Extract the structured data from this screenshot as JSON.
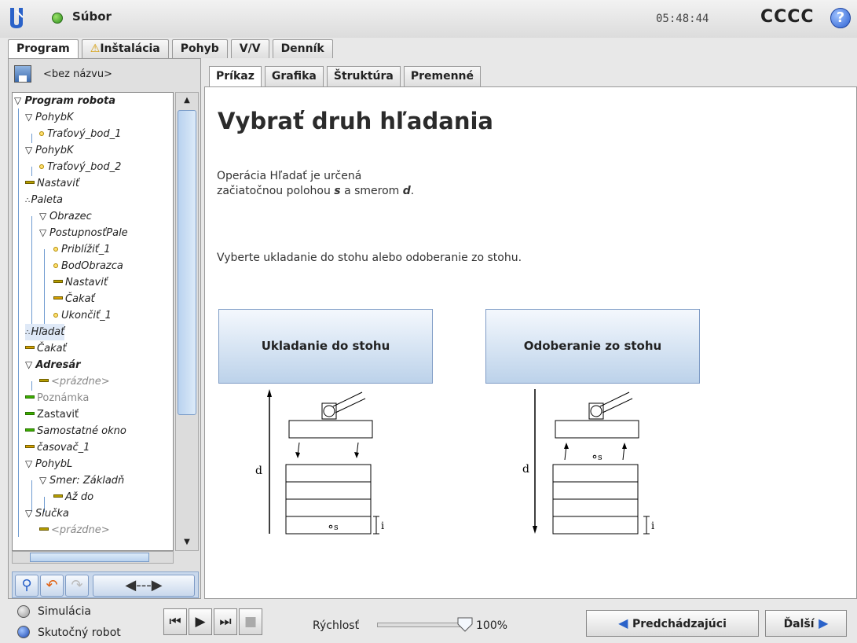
{
  "topbar": {
    "file_menu": "Súbor",
    "clock": "05:48:44",
    "robot_name": "CCCC",
    "help": "?"
  },
  "main_tabs": [
    "Program",
    "Inštalácia",
    "Pohyb",
    "V/V",
    "Denník"
  ],
  "program": {
    "name": "<bez názvu>"
  },
  "tree": [
    "Program robota",
    "PohybK",
    "Traťový_bod_1",
    "PohybK",
    "Traťový_bod_2",
    "Nastaviť",
    "Paleta",
    "Obrazec",
    "PostupnosťPale",
    "Priblížiť_1",
    "BodObrazca",
    "Nastaviť",
    "Čakať",
    "Ukončiť_1",
    "Hľadať",
    "Čakať",
    "Adresár",
    "<prázdne>",
    "Poznámka",
    "Zastaviť",
    "Samostatné okno",
    "časovač_1",
    "PohybL",
    "Smer: Základň",
    "Až do",
    "Slučka",
    "<prázdne>"
  ],
  "sub_tabs": [
    "Príkaz",
    "Grafika",
    "Štruktúra",
    "Premenné"
  ],
  "content": {
    "title": "Vybrať druh hľadania",
    "desc_line1": "Operácia Hľadať je určená",
    "desc_line2_a": "začiatočnou polohou ",
    "desc_s": "s",
    "desc_line2_b": " a smerom ",
    "desc_d": "d",
    "desc_end": ".",
    "instruction": "Vyberte ukladanie do stohu alebo odoberanie zo stohu.",
    "btn_stack": "Ukladanie do stohu",
    "btn_destack": "Odoberanie zo stohu",
    "diagram_d": "d",
    "diagram_s": "s",
    "diagram_i": "i"
  },
  "bottom": {
    "simulation": "Simulácia",
    "real_robot": "Skutočný robot",
    "speed_label": "Rýchlosť",
    "speed_value": "100%",
    "speed_fraction": 1.0,
    "prev": "Predchádzajúci",
    "next": "Ďalší"
  },
  "colors": {
    "accent_blue": "#2a62c9",
    "button_gradient": "#bcd2ea",
    "status_green": "#2e8f1c"
  }
}
